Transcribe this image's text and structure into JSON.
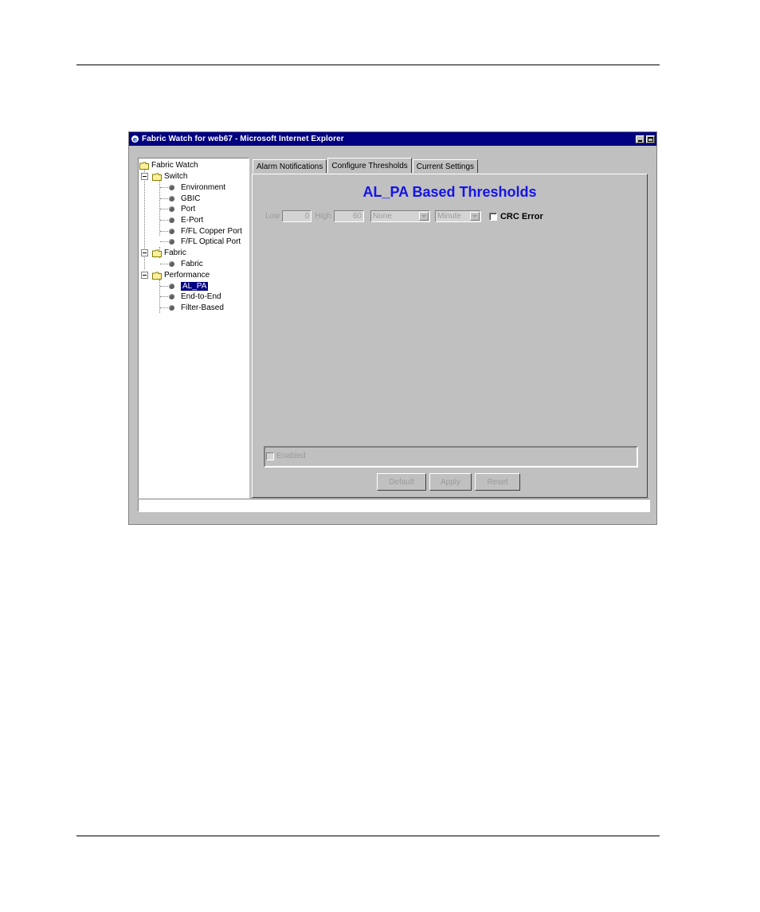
{
  "window": {
    "title": "Fabric Watch for web67 - Microsoft Internet Explorer"
  },
  "tree": {
    "root": "Fabric Watch",
    "switch": {
      "label": "Switch",
      "items": [
        "Environment",
        "GBIC",
        "Port",
        "E-Port",
        "F/FL Copper Port",
        "F/FL Optical Port"
      ]
    },
    "fabric": {
      "label": "Fabric",
      "items": [
        "Fabric"
      ]
    },
    "performance": {
      "label": "Performance",
      "items": [
        "AL_PA",
        "End-to-End",
        "Filter-Based"
      ],
      "selected": "AL_PA"
    }
  },
  "tabs": [
    "Alarm Notifications",
    "Configure Thresholds",
    "Current Settings"
  ],
  "active_tab": "Configure Thresholds",
  "panel": {
    "heading": "AL_PA Based Thresholds",
    "low_label": "Low",
    "low_value": "0",
    "high_label": "High",
    "high_value": "60",
    "unit_select": "None",
    "time_select": "Minute",
    "crc_label": "CRC Error",
    "enabled_label": "Enabled",
    "buttons": {
      "default": "Default",
      "apply": "Apply",
      "reset": "Reset"
    }
  },
  "colors": {
    "title_bar": "#000080",
    "heading": "#1414e6",
    "selection": "#000080",
    "face": "#c0c0c0"
  },
  "icons": [
    "ie-icon",
    "minimize-icon",
    "maximize-icon",
    "folder-icon",
    "expander-minus-icon",
    "leaf-bullet-icon",
    "dropdown-arrow-icon"
  ]
}
